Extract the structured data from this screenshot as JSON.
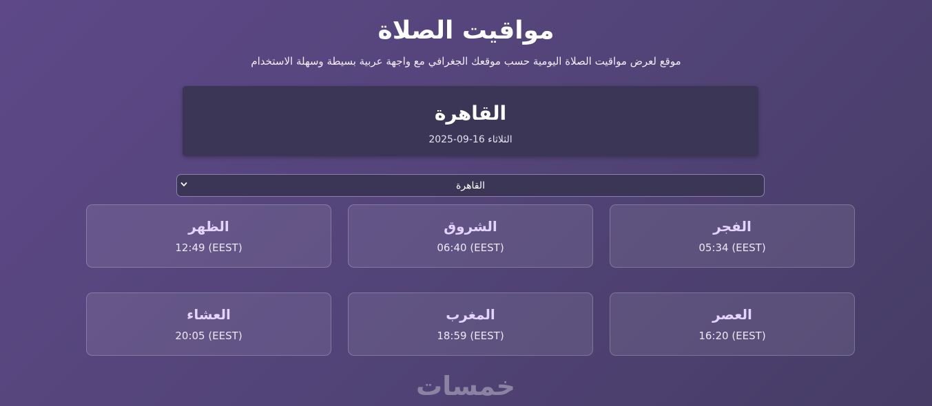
{
  "header": {
    "title": "مواقيت الصلاة",
    "subtitle": "موقع لعرض مواقيت الصلاة اليومية حسب موقعك الجغرافي مع واجهة عربية بسيطة وسهلة الاستخدام"
  },
  "city_card": {
    "name": "القاهرة",
    "date": "الثلاثاء 16-09-2025"
  },
  "city_select": {
    "selected": "القاهرة",
    "icon": "chevron-down-icon"
  },
  "prayers": [
    {
      "name": "الفجر",
      "time": "05:34 (EEST)"
    },
    {
      "name": "الشروق",
      "time": "06:40 (EEST)"
    },
    {
      "name": "الظهر",
      "time": "12:49 (EEST)"
    },
    {
      "name": "العصر",
      "time": "16:20 (EEST)"
    },
    {
      "name": "المغرب",
      "time": "18:59 (EEST)"
    },
    {
      "name": "العشاء",
      "time": "20:05 (EEST)"
    }
  ],
  "footer": {
    "logo_text": "خمسات"
  },
  "colors": {
    "background_start": "#5e4888",
    "background_end": "#463c66",
    "card_bg": "#3b3656",
    "prayer_name": "#e2d4ff",
    "logo": "#8a83a1"
  }
}
